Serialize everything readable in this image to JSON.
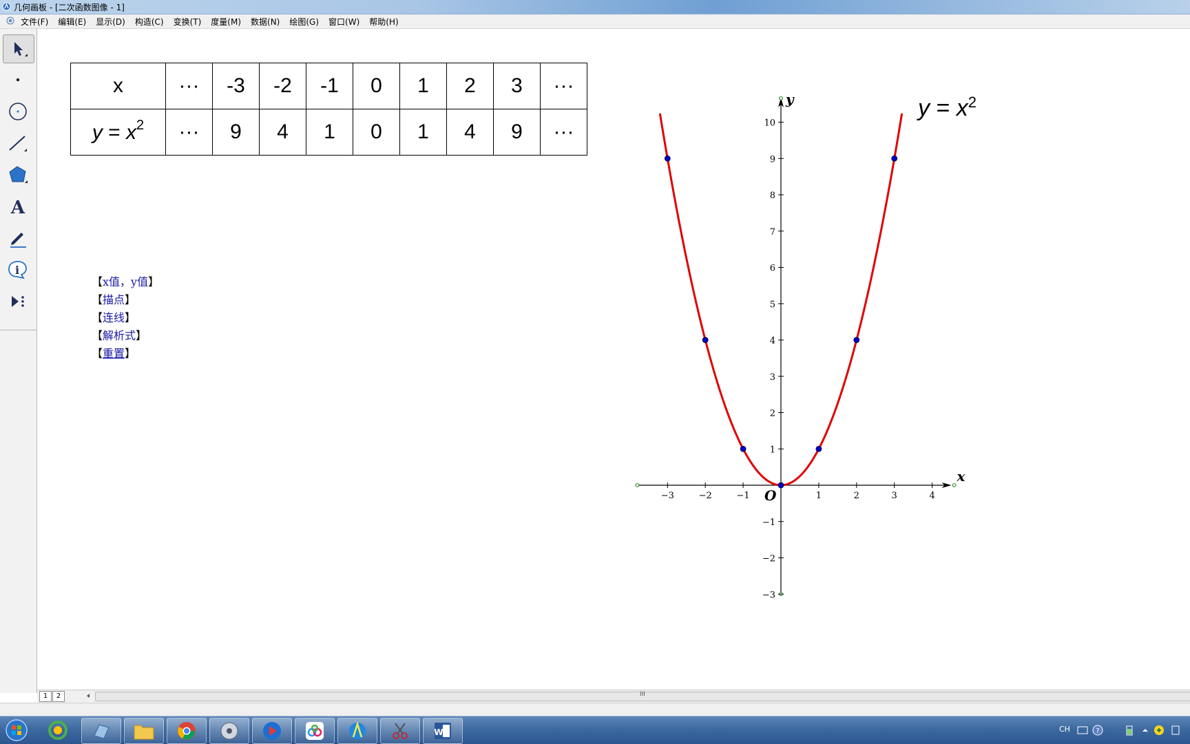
{
  "window": {
    "title": "几何画板 - [二次函数图像 - 1]"
  },
  "menu": {
    "items": [
      "文件(F)",
      "编辑(E)",
      "显示(D)",
      "构造(C)",
      "变换(T)",
      "度量(M)",
      "数据(N)",
      "绘图(G)",
      "窗口(W)",
      "帮助(H)"
    ]
  },
  "toolbox": {
    "tools": [
      "arrow-select-tool",
      "point-tool",
      "compass-tool",
      "straightedge-tool",
      "polygon-tool",
      "text-tool",
      "marker-tool",
      "information-tool",
      "custom-tool"
    ]
  },
  "table": {
    "row1_header": "x",
    "row2_header_y": "y",
    "row2_header_eq": "=",
    "row2_header_x": "x",
    "row2_header_exp": "2",
    "row1_cells": [
      "···",
      "-3",
      "-2",
      "-1",
      "0",
      "1",
      "2",
      "3",
      "···"
    ],
    "row2_cells": [
      "···",
      "9",
      "4",
      "1",
      "0",
      "1",
      "4",
      "9",
      "···"
    ]
  },
  "actions": {
    "left_bracket": "【",
    "right_bracket": "】",
    "btn1": "x值，y值",
    "btn2": "描点",
    "btn3": "连线",
    "btn4": "解析式",
    "btn5": "重置"
  },
  "graph": {
    "function_label_y": "y",
    "function_label_eq": "=",
    "function_label_x": "x",
    "function_label_exp": "2",
    "x_axis_label": "x",
    "y_axis_label": "y",
    "origin_label": "O",
    "x_tick_labels": [
      "−3",
      "−2",
      "−1",
      "1",
      "2",
      "3",
      "4"
    ],
    "y_tick_labels": [
      "10",
      "9",
      "8",
      "7",
      "6",
      "5",
      "4",
      "3",
      "2",
      "1",
      "−1",
      "−2",
      "−3"
    ],
    "curve_color": "#e00000",
    "point_color": "#0000c8"
  },
  "chart_data": {
    "type": "line",
    "title": "",
    "xlabel": "x",
    "ylabel": "y",
    "xlim": [
      -3.8,
      4.4
    ],
    "ylim": [
      -3,
      10.6
    ],
    "series": [
      {
        "name": "y = x²",
        "x": [
          -3.2,
          -3,
          -2,
          -1,
          0,
          1,
          2,
          3,
          3.2
        ],
        "values": [
          10.24,
          9,
          4,
          1,
          0,
          1,
          4,
          9,
          10.24
        ]
      }
    ],
    "points": [
      [
        -3,
        9
      ],
      [
        -2,
        4
      ],
      [
        -1,
        1
      ],
      [
        0,
        0
      ],
      [
        1,
        1
      ],
      [
        2,
        4
      ],
      [
        3,
        9
      ]
    ]
  },
  "bottom": {
    "page_tabs": [
      "1",
      "2"
    ],
    "scroll_grip": "III"
  },
  "taskbar": {
    "apps": [
      "start-orb",
      "360-app",
      "tool-app",
      "file-explorer",
      "chrome",
      "media-player",
      "video-player",
      "baidu-netdisk",
      "geometer-sketchpad",
      "snipping-tool",
      "word"
    ],
    "ime_label": "CH"
  }
}
